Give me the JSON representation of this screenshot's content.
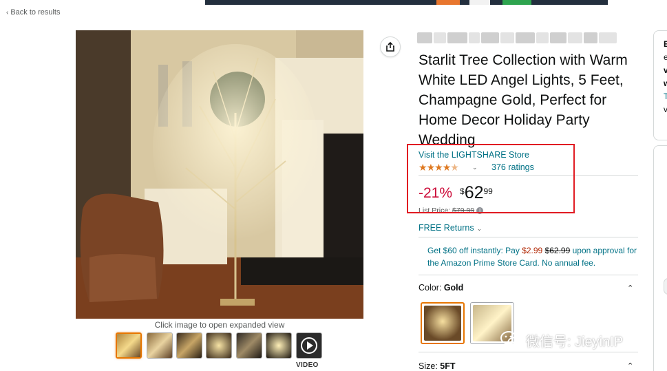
{
  "nav": {
    "back_label": "Back to results"
  },
  "product": {
    "title": "Starlit Tree Collection with Warm White LED Angel Lights, 5 Feet, Champagne Gold, Perfect for Home Decor Holiday Party Wedding",
    "store_link": "Visit the LIGHTSHARE Store",
    "rating_stars": 4.5,
    "ratings_count": "376 ratings",
    "discount": "-21%",
    "price_symbol": "$",
    "price_whole": "62",
    "price_fraction": "99",
    "list_price_label": "List Price:",
    "list_price": "$79.99",
    "free_returns": "FREE Returns",
    "promo": {
      "prefix": "Get $60 off instantly: Pay ",
      "pay_price": "$2.99",
      "old_price": "$62.99",
      "suffix": " upon approval for the Amazon Prime Store Card. No annual fee."
    },
    "color_label": "Color: ",
    "color_value": "Gold",
    "size_label": "Size: ",
    "size_value": "5FT"
  },
  "gallery": {
    "caption": "Click image to open expanded view",
    "video_label": "VIDEO",
    "selected_thumb": 0
  },
  "buybox": {
    "letters": [
      "E",
      "e",
      "v",
      "w",
      "T",
      "v"
    ]
  },
  "watermark": {
    "text": "微信号: JieyinIP"
  },
  "colors": {
    "link": "#007185",
    "deal_red": "#cc0c39",
    "star": "#de7921",
    "highlight_box": "#e11b22",
    "selected_border": "#e77600"
  }
}
